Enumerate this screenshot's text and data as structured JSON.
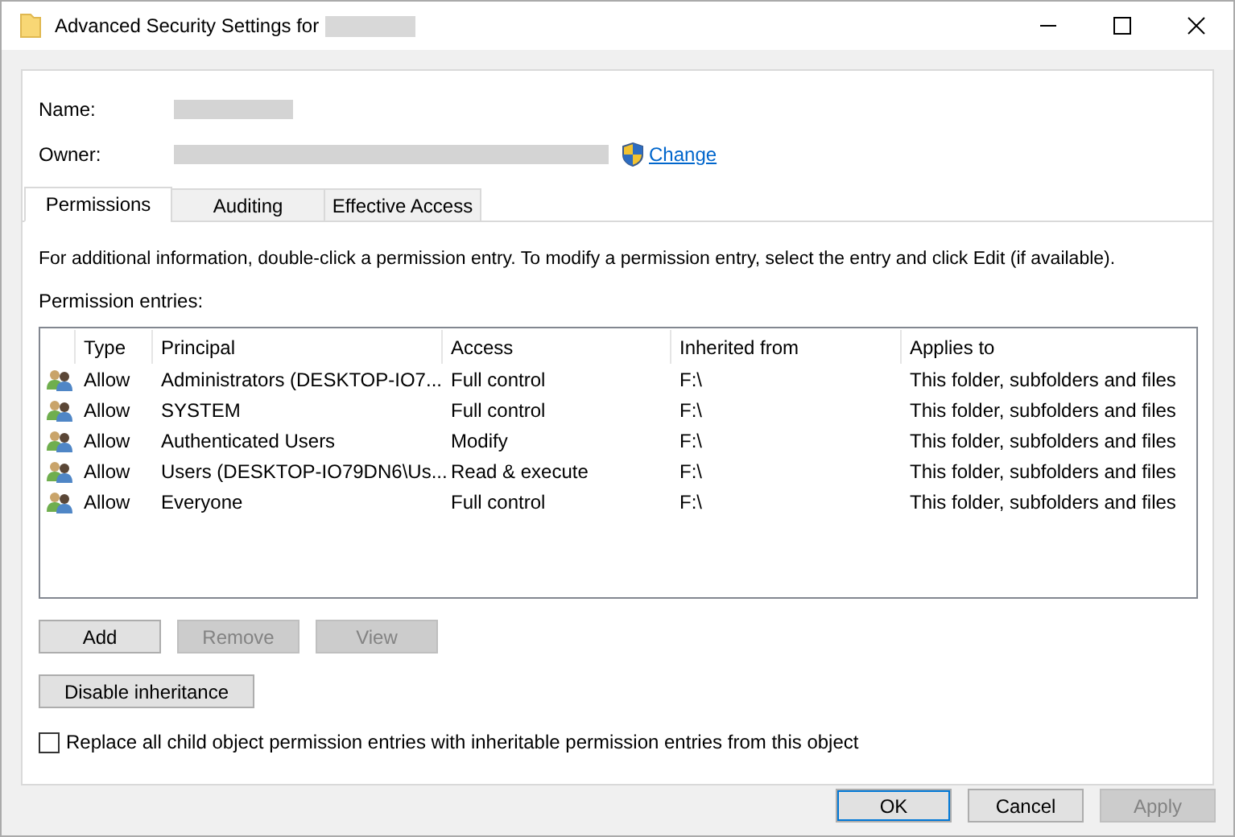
{
  "window": {
    "title": "Advanced Security Settings for"
  },
  "fields": [
    {
      "label": "Name:",
      "redacted": true
    },
    {
      "label": "Owner:",
      "redacted": true,
      "link": "Change"
    }
  ],
  "tabs": [
    {
      "label": "Permissions",
      "selected": true
    },
    {
      "label": "Auditing",
      "selected": false
    },
    {
      "label": "Effective Access",
      "selected": false
    }
  ],
  "info": "For additional information, double-click a permission entry. To modify a permission entry, select the entry and click Edit (if available).",
  "entries_label": "Permission entries:",
  "table": {
    "columns": [
      "Type",
      "Principal",
      "Access",
      "Inherited from",
      "Applies to"
    ],
    "rows": [
      [
        "Allow",
        "Administrators (DESKTOP-IO7...",
        "Full control",
        "F:\\",
        "This folder, subfolders and files"
      ],
      [
        "Allow",
        "SYSTEM",
        "Full control",
        "F:\\",
        "This folder, subfolders and files"
      ],
      [
        "Allow",
        "Authenticated Users",
        "Modify",
        "F:\\",
        "This folder, subfolders and files"
      ],
      [
        "Allow",
        "Users (DESKTOP-IO79DN6\\Us...",
        "Read & execute",
        "F:\\",
        "This folder, subfolders and files"
      ],
      [
        "Allow",
        "Everyone",
        "Full control",
        "F:\\",
        "This folder, subfolders and files"
      ]
    ]
  },
  "entry_buttons": [
    {
      "label": "Add",
      "disabled": false
    },
    {
      "label": "Remove",
      "disabled": true
    },
    {
      "label": "View",
      "disabled": true
    }
  ],
  "inheritance_button": {
    "label": "Disable inheritance",
    "disabled": false
  },
  "replace_checkbox": {
    "label": "Replace all child object permission entries with inheritable permission entries from this object",
    "checked": false
  },
  "dialog_buttons": [
    {
      "label": "OK",
      "disabled": false,
      "default": true
    },
    {
      "label": "Cancel",
      "disabled": false,
      "default": false
    },
    {
      "label": "Apply",
      "disabled": true,
      "default": false
    }
  ]
}
